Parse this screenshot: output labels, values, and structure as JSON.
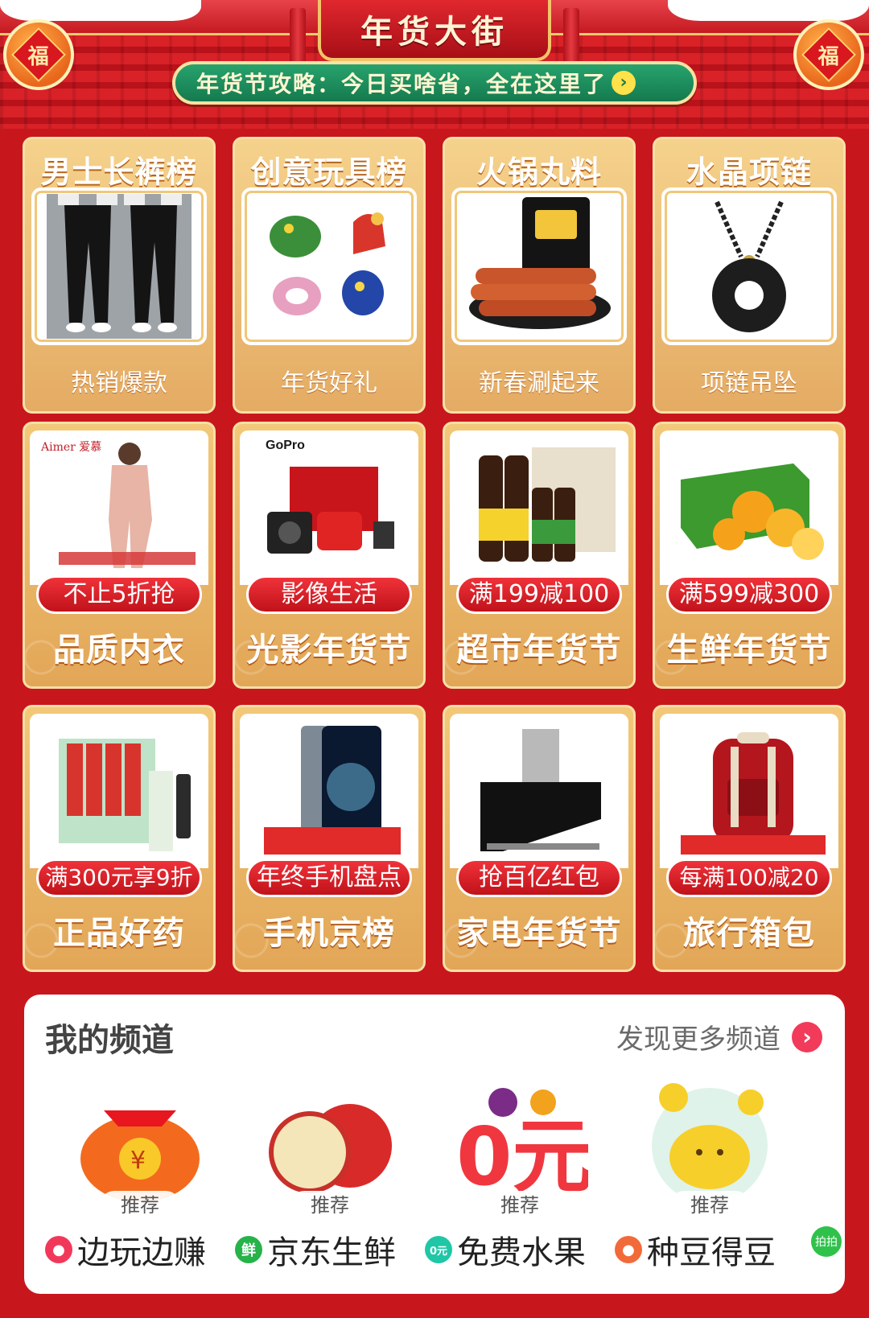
{
  "header": {
    "title": "年货大街",
    "banner": "年货节攻略：今日买啥省，全在这里了",
    "badge_char": "福"
  },
  "rank_cards": [
    {
      "title": "男士长裤榜",
      "subtitle": "热销爆款"
    },
    {
      "title": "创意玩具榜",
      "subtitle": "年货好礼"
    },
    {
      "title": "火锅丸料",
      "subtitle": "新春涮起来"
    },
    {
      "title": "水晶项链",
      "subtitle": "项链吊坠"
    }
  ],
  "promo_cards": [
    {
      "pill": "不止5折抢",
      "title": "品质内衣"
    },
    {
      "pill": "影像生活",
      "title": "光影年货节"
    },
    {
      "pill": "满199减100",
      "title": "超市年货节"
    },
    {
      "pill": "满599减300",
      "title": "生鲜年货节"
    },
    {
      "pill": "满300元享9折",
      "title": "正品好药"
    },
    {
      "pill": "年终手机盘点",
      "title": "手机京榜"
    },
    {
      "pill": "抢百亿红包",
      "title": "家电年货节"
    },
    {
      "pill": "每满100减20",
      "title": "旅行箱包"
    }
  ],
  "product_image_text": {
    "aimer": "Aimer 爱慕",
    "gopro": "GoPro",
    "zero_yuan": "0元"
  },
  "channels": {
    "title": "我的频道",
    "more": "发现更多频道",
    "items": [
      {
        "tag": "推荐",
        "name": "边玩边赚",
        "icon": "game-icon",
        "icon_text": ""
      },
      {
        "tag": "推荐",
        "name": "京东生鲜",
        "icon": "fresh-icon",
        "icon_text": "鲜"
      },
      {
        "tag": "推荐",
        "name": "免费水果",
        "icon": "free-fruit-icon",
        "icon_text": "0元"
      },
      {
        "tag": "推荐",
        "name": "种豆得豆",
        "icon": "bean-icon",
        "icon_text": ""
      },
      {
        "tag": "",
        "name": "",
        "icon": "paipai-icon",
        "icon_text": "拍拍"
      }
    ]
  },
  "colors": {
    "page_bg": "#c8161d",
    "card_gold": "#e4ab63",
    "pill_red": "#d81e26",
    "banner_green": "#1d8a5b"
  }
}
